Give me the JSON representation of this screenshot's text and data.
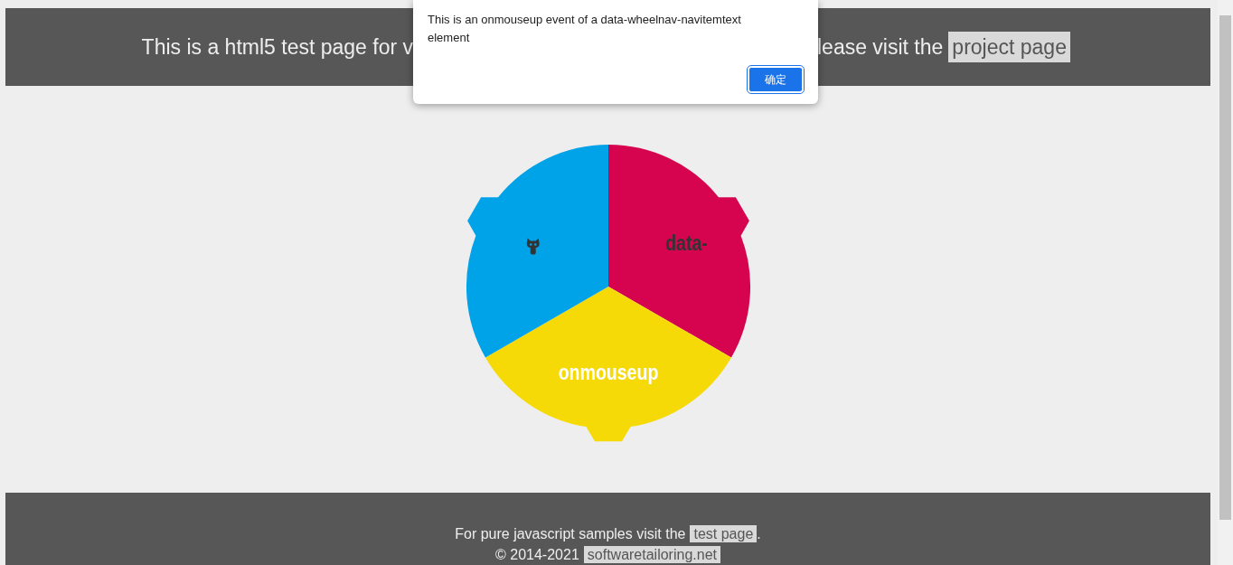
{
  "header": {
    "text_before": "This is a html5 test page for v",
    "text_after": "lease visit the",
    "link": "project page"
  },
  "wheel": {
    "items": [
      {
        "kind": "text",
        "label": "data-",
        "color": "#d6044f",
        "selected": false
      },
      {
        "kind": "text",
        "label": "onmouseup",
        "color": "#f5da08",
        "selected": true
      },
      {
        "kind": "icon",
        "color": "#00a2e8",
        "selected": false
      }
    ]
  },
  "footer": {
    "lines": [
      {
        "text": "For pure javascript samples visit the",
        "link": "test page",
        "after": "."
      },
      {
        "text": "© 2014-2021",
        "link": "softwaretailoring.net"
      }
    ]
  },
  "dialog": {
    "message": "This is an onmouseup event of a data-wheelnav-navitemtext element",
    "button": "确定"
  }
}
